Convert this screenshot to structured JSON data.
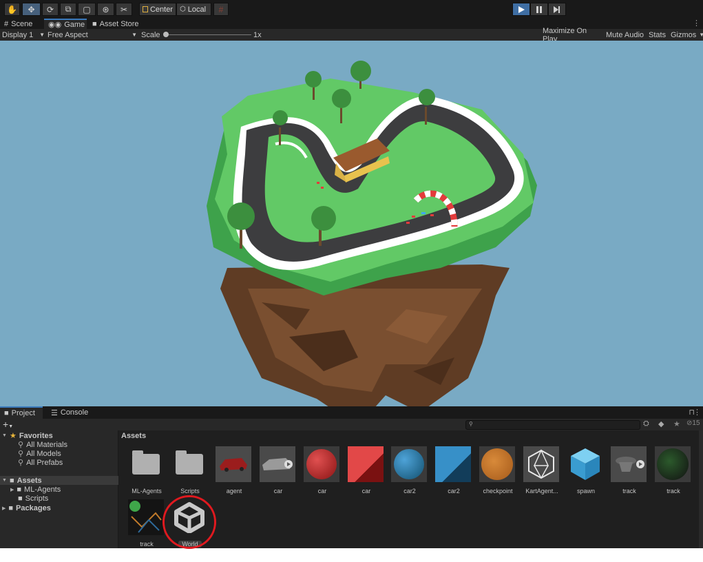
{
  "toolbar": {
    "tools": [
      "hand-tool",
      "move-tool",
      "rotate-tool",
      "scale-tool",
      "rect-tool",
      "transform-tool",
      "custom-tool"
    ],
    "pivot_label": "Center",
    "space_label": "Local"
  },
  "tabs": {
    "scene": "Scene",
    "game": "Game",
    "asset_store": "Asset Store"
  },
  "game_bar": {
    "display": "Display 1",
    "aspect": "Free Aspect",
    "scale_label": "Scale",
    "scale_value": "1x",
    "maximize": "Maximize On Play",
    "mute": "Mute Audio",
    "stats": "Stats",
    "gizmos": "Gizmos"
  },
  "project": {
    "tab_project": "Project",
    "tab_console": "Console",
    "add_label": "+",
    "favorites": {
      "title": "Favorites",
      "items": [
        "All Materials",
        "All Models",
        "All Prefabs"
      ]
    },
    "tree": {
      "assets": "Assets",
      "children": [
        "ML-Agents",
        "Scripts"
      ],
      "packages": "Packages"
    },
    "breadcrumb": "Assets",
    "hidden_count": "15"
  },
  "assets": [
    {
      "name": "ML-Agents",
      "type": "folder"
    },
    {
      "name": "Scripts",
      "type": "folder"
    },
    {
      "name": "agent",
      "type": "prefab-red-car"
    },
    {
      "name": "car",
      "type": "model-grey-car"
    },
    {
      "name": "car",
      "type": "material-red-sphere"
    },
    {
      "name": "car",
      "type": "texture-red"
    },
    {
      "name": "car2",
      "type": "material-blue-sphere"
    },
    {
      "name": "car2",
      "type": "texture-blue"
    },
    {
      "name": "checkpoint",
      "type": "material-orange"
    },
    {
      "name": "KartAgent...",
      "type": "mesh-icosahedron"
    },
    {
      "name": "spawn",
      "type": "prefab-cube"
    },
    {
      "name": "track",
      "type": "model-track"
    },
    {
      "name": "track",
      "type": "material-track"
    },
    {
      "name": "track",
      "type": "texture-track"
    },
    {
      "name": "World",
      "type": "unity-scene"
    }
  ],
  "colors": {
    "viewport_bg": "#79aac4",
    "selection_blue": "#3f6ea3",
    "annotation_red": "#e0191f"
  }
}
